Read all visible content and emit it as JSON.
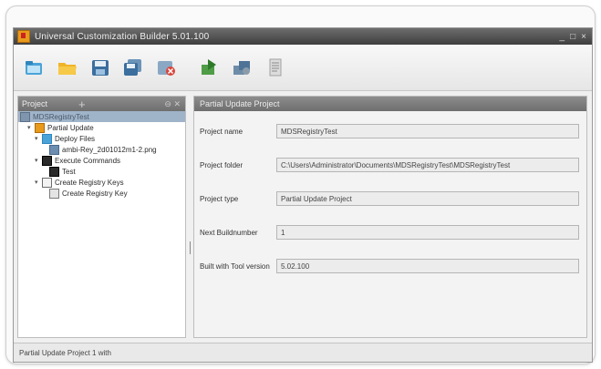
{
  "window": {
    "title": "Universal Customization Builder 5.01.100",
    "controls": [
      "_",
      "□",
      "×"
    ]
  },
  "toolbar": {
    "buttons": [
      {
        "icon": "new-project-icon"
      },
      {
        "icon": "open-folder-icon"
      },
      {
        "icon": "save-icon"
      },
      {
        "icon": "save-all-icon"
      },
      {
        "icon": "close-project-icon"
      },
      {
        "icon": "build-icon"
      },
      {
        "icon": "build-all-icon"
      },
      {
        "icon": "document-icon"
      }
    ]
  },
  "left_pane": {
    "header": "Project",
    "tree": [
      {
        "label": "MDSRegistryTest",
        "level": 0,
        "selected": true
      },
      {
        "label": "Partial Update",
        "level": 1
      },
      {
        "label": "Deploy Files",
        "level": 2
      },
      {
        "label": "ambi-Rey_2d01012m1-2.png",
        "level": 3
      },
      {
        "label": "Execute Commands",
        "level": 2
      },
      {
        "label": "Test",
        "level": 3
      },
      {
        "label": "Create Registry Keys",
        "level": 2
      },
      {
        "label": "Create Registry Key",
        "level": 3
      }
    ]
  },
  "right_pane": {
    "header": "Partial Update Project",
    "properties": [
      {
        "label": "Project name",
        "value": "MDSRegistryTest"
      },
      {
        "label": "Project folder",
        "value": "C:\\Users\\Administrator\\Documents\\MDSRegistryTest\\MDSRegistryTest"
      },
      {
        "label": "Project type",
        "value": "Partial Update Project"
      },
      {
        "label": "Next Buildnumber",
        "value": "1"
      },
      {
        "label": "Built with Tool version",
        "value": "5.02.100"
      }
    ]
  },
  "status": {
    "text": "Partial Update Project 1 with"
  },
  "colors": {
    "titlebar": "#4a4a4a",
    "selection": "#9fb3c9",
    "accent": "#e89a1c"
  }
}
